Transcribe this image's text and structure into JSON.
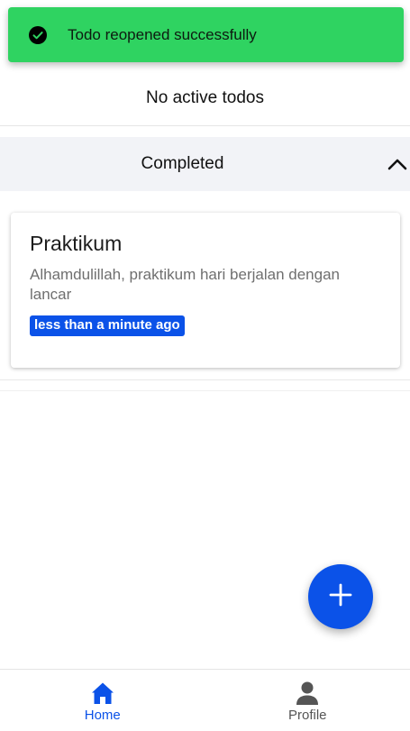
{
  "toast": {
    "message": "Todo reopened successfully",
    "icon": "check-circle-icon",
    "color": "#2fd361"
  },
  "active_section": {
    "empty_text": "No active todos"
  },
  "completed_section": {
    "label": "Completed",
    "expanded": true,
    "toggle_icon": "chevron-up-icon"
  },
  "todos": [
    {
      "title": "Praktikum",
      "description": "Alhamdulillah, praktikum hari berjalan dengan lancar",
      "time": "less than a minute ago"
    }
  ],
  "fab": {
    "icon": "plus-icon"
  },
  "bottom_nav": {
    "items": [
      {
        "label": "Home",
        "icon": "home-icon",
        "active": true
      },
      {
        "label": "Profile",
        "icon": "person-icon",
        "active": false
      }
    ]
  },
  "colors": {
    "accent": "#0b52e8",
    "success": "#2fd361",
    "section_bg": "#f2f3f7"
  }
}
